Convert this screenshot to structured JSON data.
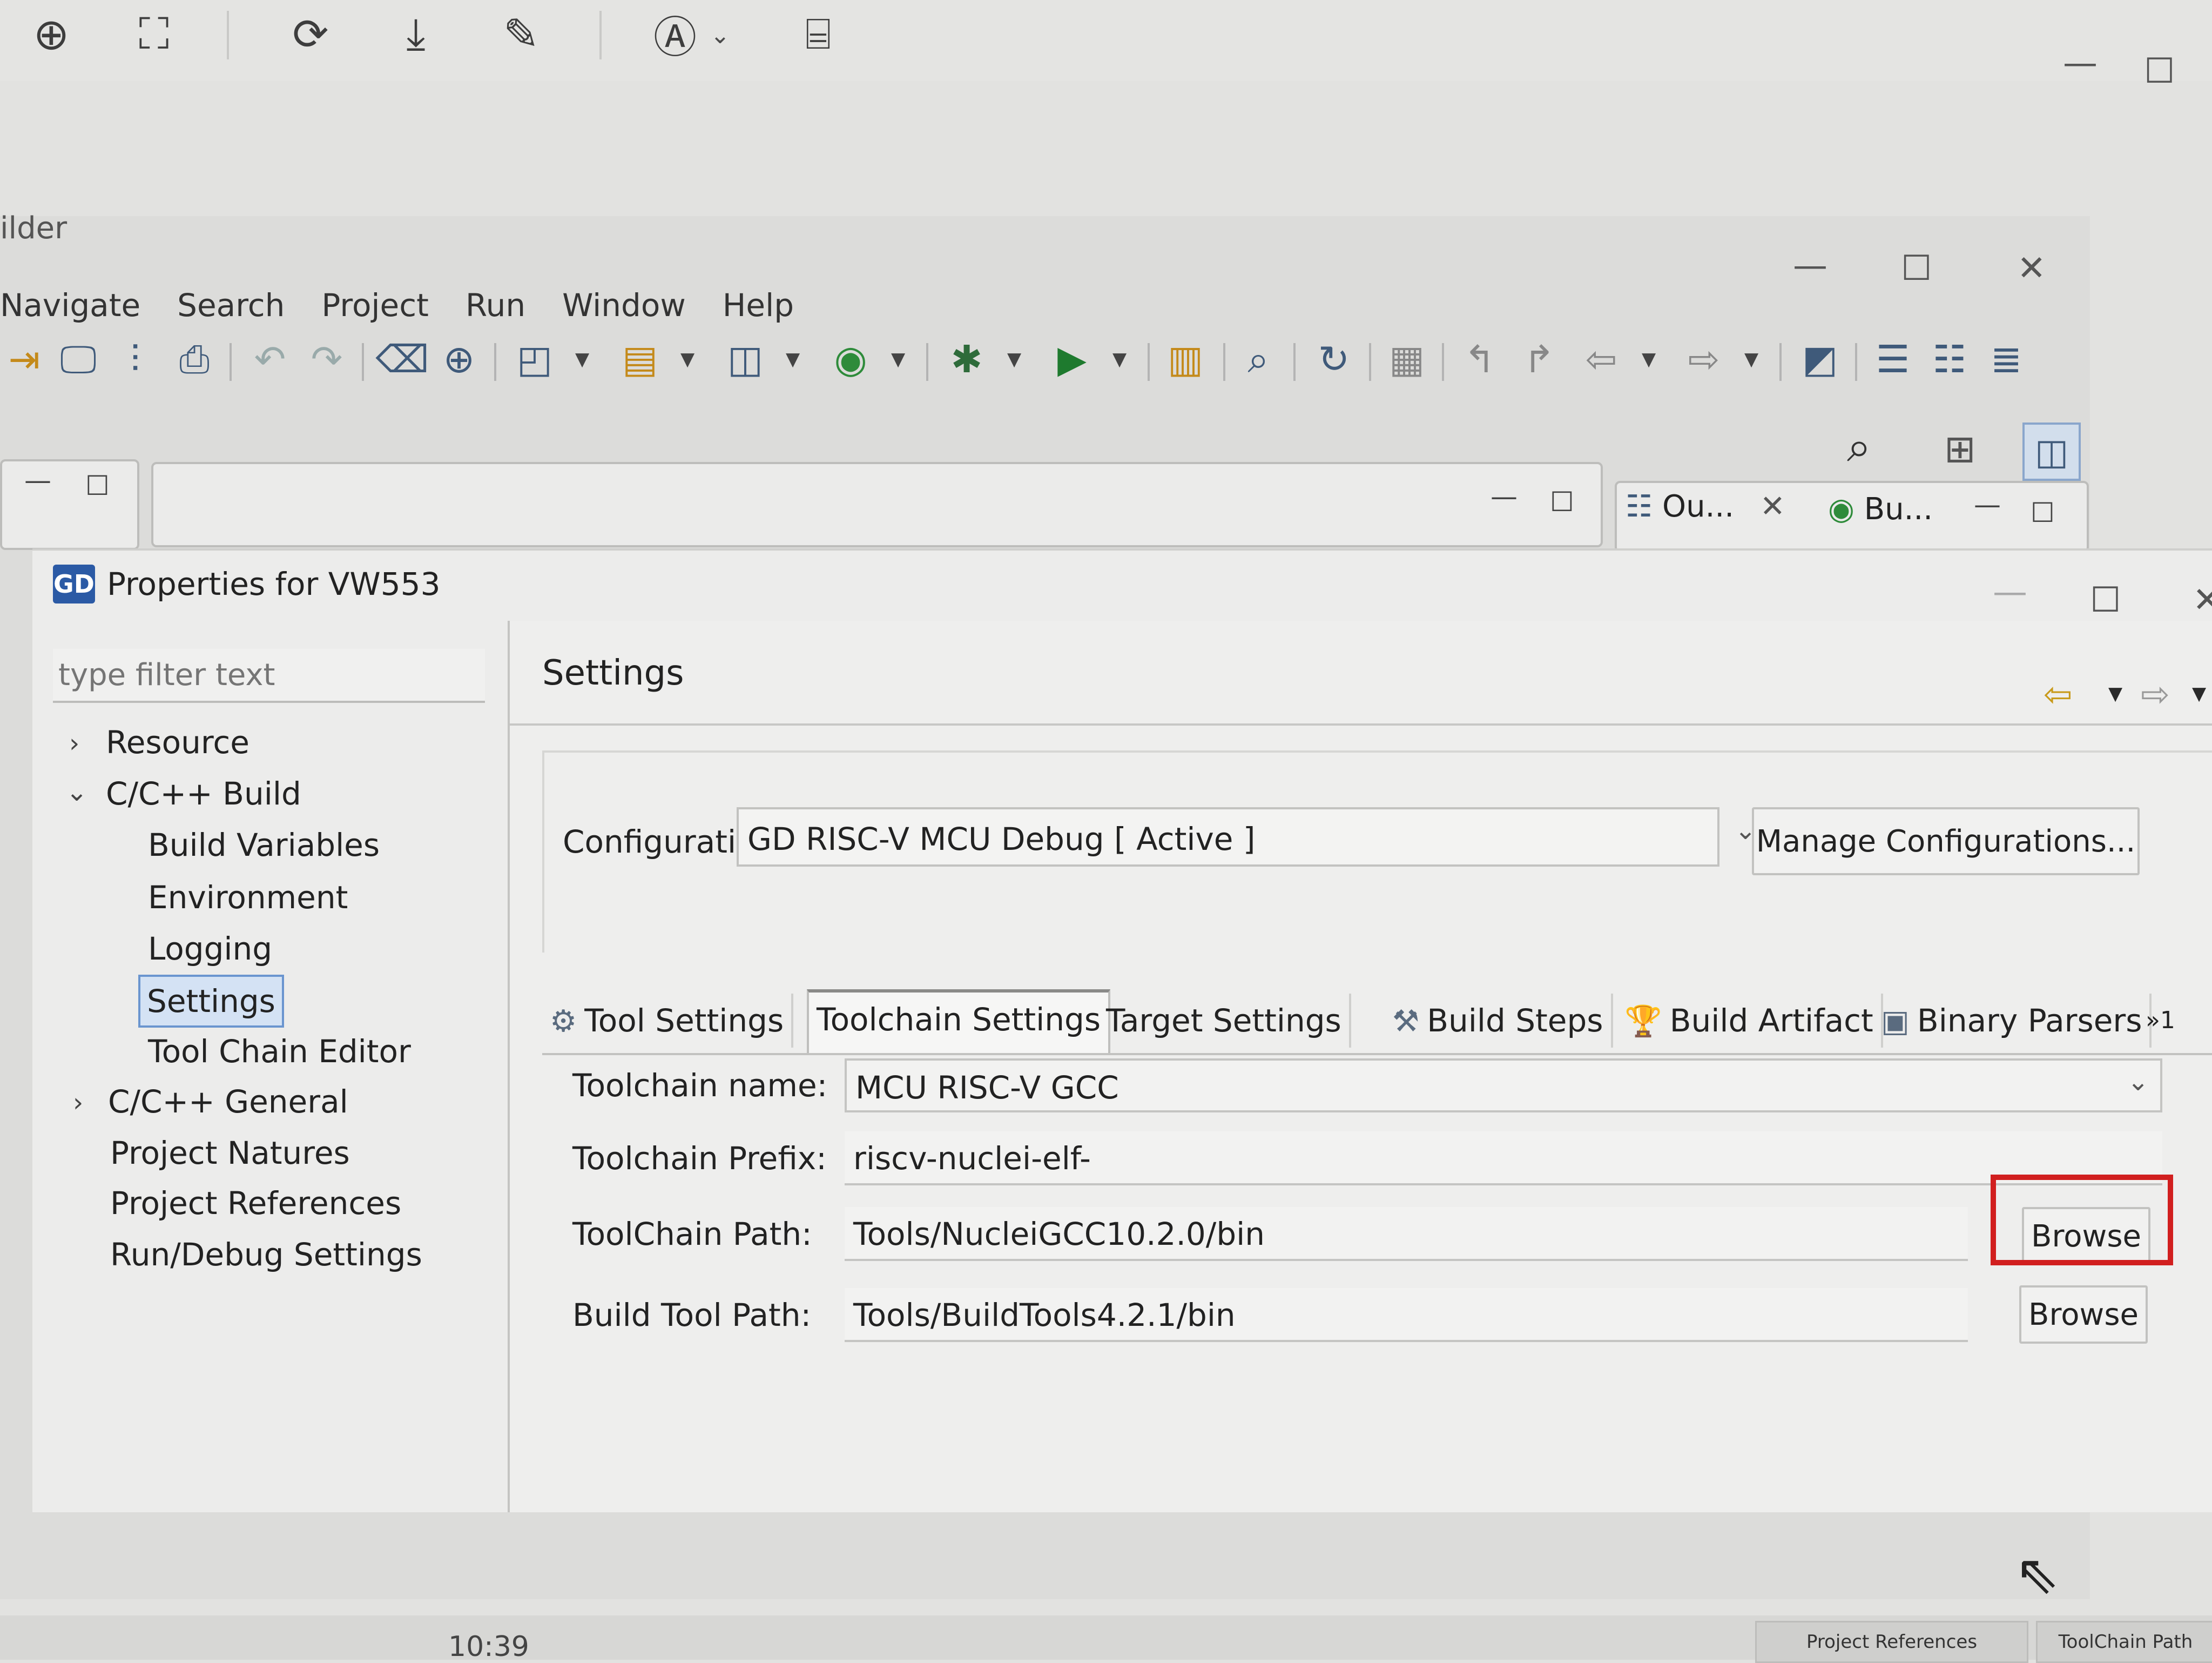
{
  "viewer_toolbar": {
    "icons": [
      "zoom-in-icon",
      "fit-screen-icon",
      "rotate-icon",
      "download-icon",
      "edit-icon",
      "auto-enhance-icon",
      "scan-text-icon"
    ]
  },
  "eclipse": {
    "title_fragment": "ilder",
    "menu": [
      "Navigate",
      "Search",
      "Project",
      "Run",
      "Window",
      "Help"
    ]
  },
  "views": {
    "outline_tab": "Ou...",
    "build_tab": "Bu..."
  },
  "dialog": {
    "logo": "GD",
    "title": "Properties for VW553",
    "filter_placeholder": "type filter text",
    "tree": {
      "resource": "Resource",
      "cpp_build": "C/C++ Build",
      "build_variables": "Build Variables",
      "environment": "Environment",
      "logging": "Logging",
      "settings": "Settings",
      "tool_chain_editor": "Tool Chain Editor",
      "cpp_general": "C/C++ General",
      "project_natures": "Project Natures",
      "project_references": "Project References",
      "run_debug_settings": "Run/Debug Settings"
    },
    "page_title": "Settings",
    "configuration_label": "Configuration:",
    "configuration_value": "GD RISC-V MCU Debug  [ Active ]",
    "manage_button": "Manage Configurations...",
    "tabs": {
      "tool_settings": "Tool Settings",
      "toolchain_settings": "Toolchain Settings",
      "target_settings": "Target Settings",
      "build_steps": "Build Steps",
      "build_artifact": "Build Artifact",
      "binary_parsers": "Binary Parsers",
      "overflow": "»1"
    },
    "fields": {
      "toolchain_name_label": "Toolchain name:",
      "toolchain_name_value": "MCU RISC-V GCC",
      "toolchain_prefix_label": "Toolchain Prefix:",
      "toolchain_prefix_value": "riscv-nuclei-elf-",
      "toolchain_path_label": "ToolChain Path:",
      "toolchain_path_value": "Tools/NucleiGCC10.2.0/bin",
      "build_tool_path_label": "Build Tool Path:",
      "build_tool_path_value": "Tools/BuildTools4.2.1/bin",
      "browse_label": "Browse"
    },
    "highlight_color": "#d11f1f"
  },
  "taskbar": {
    "clock": "10:39",
    "thumb1": "Project References",
    "thumb2": "ToolChain Path"
  }
}
